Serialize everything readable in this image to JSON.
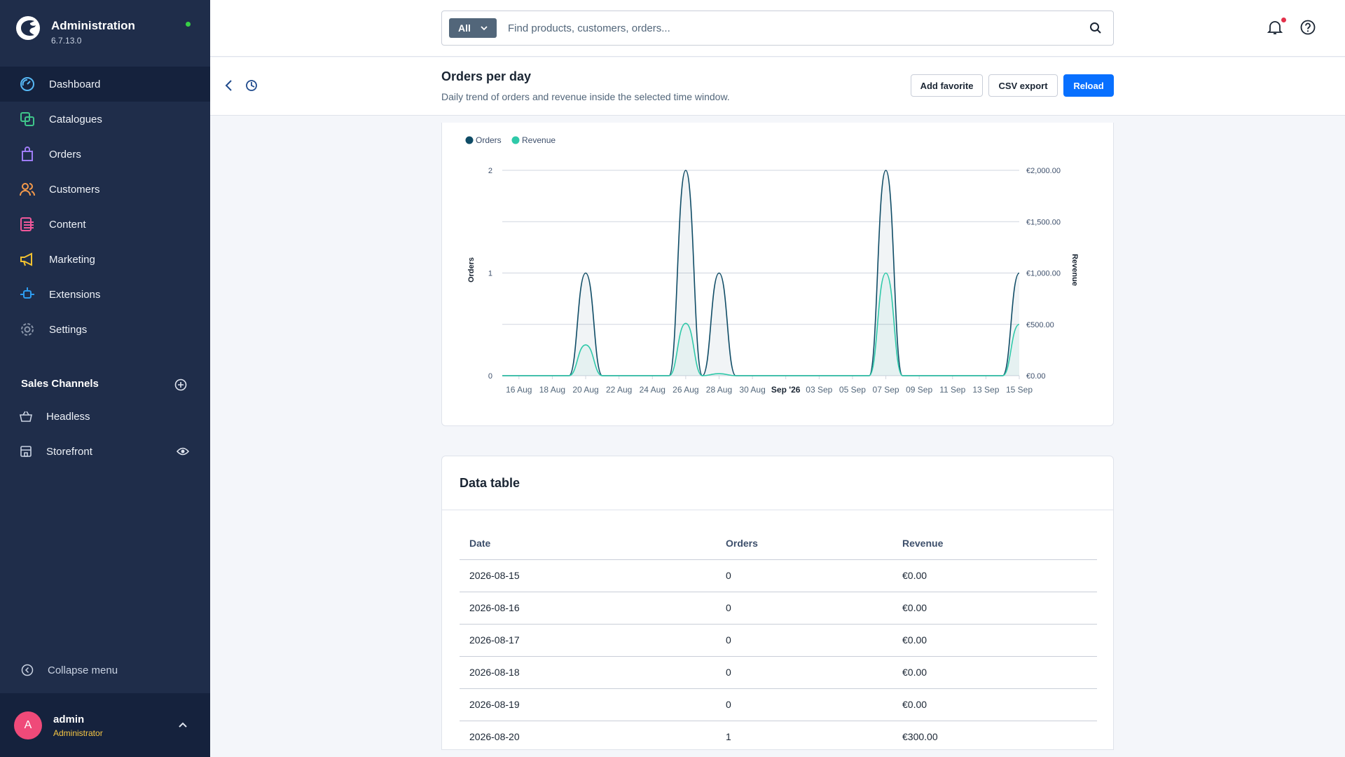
{
  "app": {
    "title": "Administration",
    "version": "6.7.13.0"
  },
  "nav": {
    "items": [
      {
        "label": "Dashboard",
        "icon": "dashboard-icon",
        "active": true
      },
      {
        "label": "Catalogues",
        "icon": "catalogues-icon"
      },
      {
        "label": "Orders",
        "icon": "orders-icon"
      },
      {
        "label": "Customers",
        "icon": "customers-icon"
      },
      {
        "label": "Content",
        "icon": "content-icon"
      },
      {
        "label": "Marketing",
        "icon": "marketing-icon"
      },
      {
        "label": "Extensions",
        "icon": "extensions-icon"
      },
      {
        "label": "Settings",
        "icon": "settings-icon"
      }
    ],
    "sales_channels_title": "Sales Channels",
    "channels": [
      {
        "label": "Headless",
        "icon": "basket-icon"
      },
      {
        "label": "Storefront",
        "icon": "storefront-icon"
      }
    ],
    "collapse_label": "Collapse menu"
  },
  "user": {
    "initial": "A",
    "name": "admin",
    "role": "Administrator"
  },
  "search": {
    "scope": "All",
    "placeholder": "Find products, customers, orders..."
  },
  "page": {
    "title": "Orders per day",
    "subtitle": "Daily trend of orders and revenue inside the selected time window.",
    "buttons": {
      "favorite": "Add favorite",
      "csv": "CSV export",
      "reload": "Reload"
    }
  },
  "colors": {
    "orders": "#0f4c66",
    "revenue": "#2fc9a9",
    "primary": "#0870ff",
    "sidebar": "#1f2d4a"
  },
  "chart_data": {
    "type": "line",
    "legend": [
      "Orders",
      "Revenue"
    ],
    "legend_position": "top-left",
    "y_left_label": "Orders",
    "y_right_label": "Revenue",
    "y_left_ticks": [
      "0",
      "1",
      "2"
    ],
    "y_right_ticks": [
      "€0.00",
      "€500.00",
      "€1,000.00",
      "€1,500.00",
      "€2,000.00"
    ],
    "x_tick_labels": [
      "16 Aug",
      "18 Aug",
      "20 Aug",
      "22 Aug",
      "24 Aug",
      "26 Aug",
      "28 Aug",
      "30 Aug",
      "Sep '26",
      "03 Sep",
      "05 Sep",
      "07 Sep",
      "09 Sep",
      "11 Sep",
      "13 Sep",
      "15 Sep"
    ],
    "y_left_range": [
      0,
      2
    ],
    "y_right_range": [
      0,
      2000
    ],
    "grid": true,
    "x": [
      "2026-08-15",
      "2026-08-16",
      "2026-08-17",
      "2026-08-18",
      "2026-08-19",
      "2026-08-20",
      "2026-08-21",
      "2026-08-22",
      "2026-08-23",
      "2026-08-24",
      "2026-08-25",
      "2026-08-26",
      "2026-08-27",
      "2026-08-28",
      "2026-08-29",
      "2026-08-30",
      "2026-08-31",
      "2026-09-01",
      "2026-09-02",
      "2026-09-03",
      "2026-09-04",
      "2026-09-05",
      "2026-09-06",
      "2026-09-07",
      "2026-09-08",
      "2026-09-09",
      "2026-09-10",
      "2026-09-11",
      "2026-09-12",
      "2026-09-13",
      "2026-09-14",
      "2026-09-15"
    ],
    "series": [
      {
        "name": "Orders",
        "axis": "left",
        "values": [
          0,
          0,
          0,
          0,
          0,
          1,
          0,
          0,
          0,
          0,
          0,
          2,
          0,
          1,
          0,
          0,
          0,
          0,
          0,
          0,
          0,
          0,
          0,
          2,
          0,
          0,
          0,
          0,
          0,
          0,
          0,
          1
        ]
      },
      {
        "name": "Revenue",
        "axis": "right",
        "values": [
          0,
          0,
          0,
          0,
          0,
          300,
          0,
          0,
          0,
          0,
          0,
          510,
          0,
          20,
          0,
          0,
          0,
          0,
          0,
          0,
          0,
          0,
          0,
          1000,
          0,
          0,
          0,
          0,
          0,
          0,
          0,
          500
        ]
      }
    ]
  },
  "table": {
    "title": "Data table",
    "headers": [
      "Date",
      "Orders",
      "Revenue"
    ],
    "rows": [
      [
        "2026-08-15",
        "0",
        "€0.00"
      ],
      [
        "2026-08-16",
        "0",
        "€0.00"
      ],
      [
        "2026-08-17",
        "0",
        "€0.00"
      ],
      [
        "2026-08-18",
        "0",
        "€0.00"
      ],
      [
        "2026-08-19",
        "0",
        "€0.00"
      ],
      [
        "2026-08-20",
        "1",
        "€300.00"
      ]
    ]
  }
}
